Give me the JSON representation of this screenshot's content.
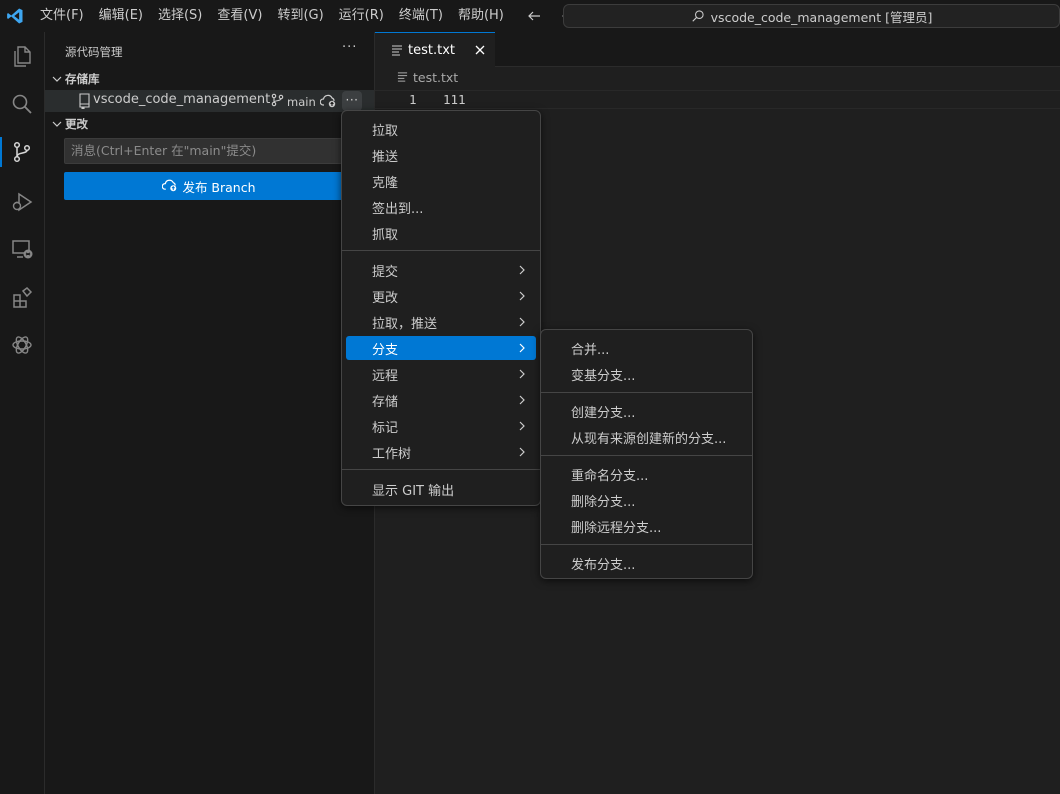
{
  "titlebar": {
    "menu": [
      "文件(F)",
      "编辑(E)",
      "选择(S)",
      "查看(V)",
      "转到(G)",
      "运行(R)",
      "终端(T)",
      "帮助(H)"
    ],
    "command_center": "vscode_code_management [管理员]"
  },
  "activitybar": {
    "items": [
      "explorer",
      "search",
      "source-control",
      "run-debug",
      "remote-explorer",
      "extensions",
      "chatgpt"
    ]
  },
  "sidebar": {
    "title": "源代码管理",
    "more": "···",
    "repos_header": "存储库",
    "repo": {
      "name": "vscode_code_management",
      "branch": "main",
      "more": "···"
    },
    "changes_header": "更改",
    "commit_placeholder": "消息(Ctrl+Enter 在\"main\"提交)",
    "publish_label": "发布 Branch"
  },
  "editor": {
    "tab": {
      "label": "test.txt"
    },
    "breadcrumb": "test.txt",
    "lines": [
      {
        "number": "1",
        "text": "111"
      }
    ]
  },
  "context_menu": {
    "group1": [
      "拉取",
      "推送",
      "克隆",
      "签出到...",
      "抓取"
    ],
    "group2": [
      "提交",
      "更改",
      "拉取，推送",
      "分支",
      "远程",
      "存储",
      "标记",
      "工作树"
    ],
    "selected": "分支",
    "group3": [
      "显示 GIT 输出"
    ]
  },
  "submenu": {
    "group1": [
      "合并...",
      "变基分支..."
    ],
    "group2": [
      "创建分支...",
      "从现有来源创建新的分支..."
    ],
    "group3": [
      "重命名分支...",
      "删除分支...",
      "删除远程分支..."
    ],
    "group4": [
      "发布分支..."
    ]
  },
  "colors": {
    "accent": "#0078d4",
    "background": "#1f1f1f",
    "sidebar": "#181818",
    "menu_border": "#454545",
    "vscode_logo": "#3ea6f0"
  }
}
